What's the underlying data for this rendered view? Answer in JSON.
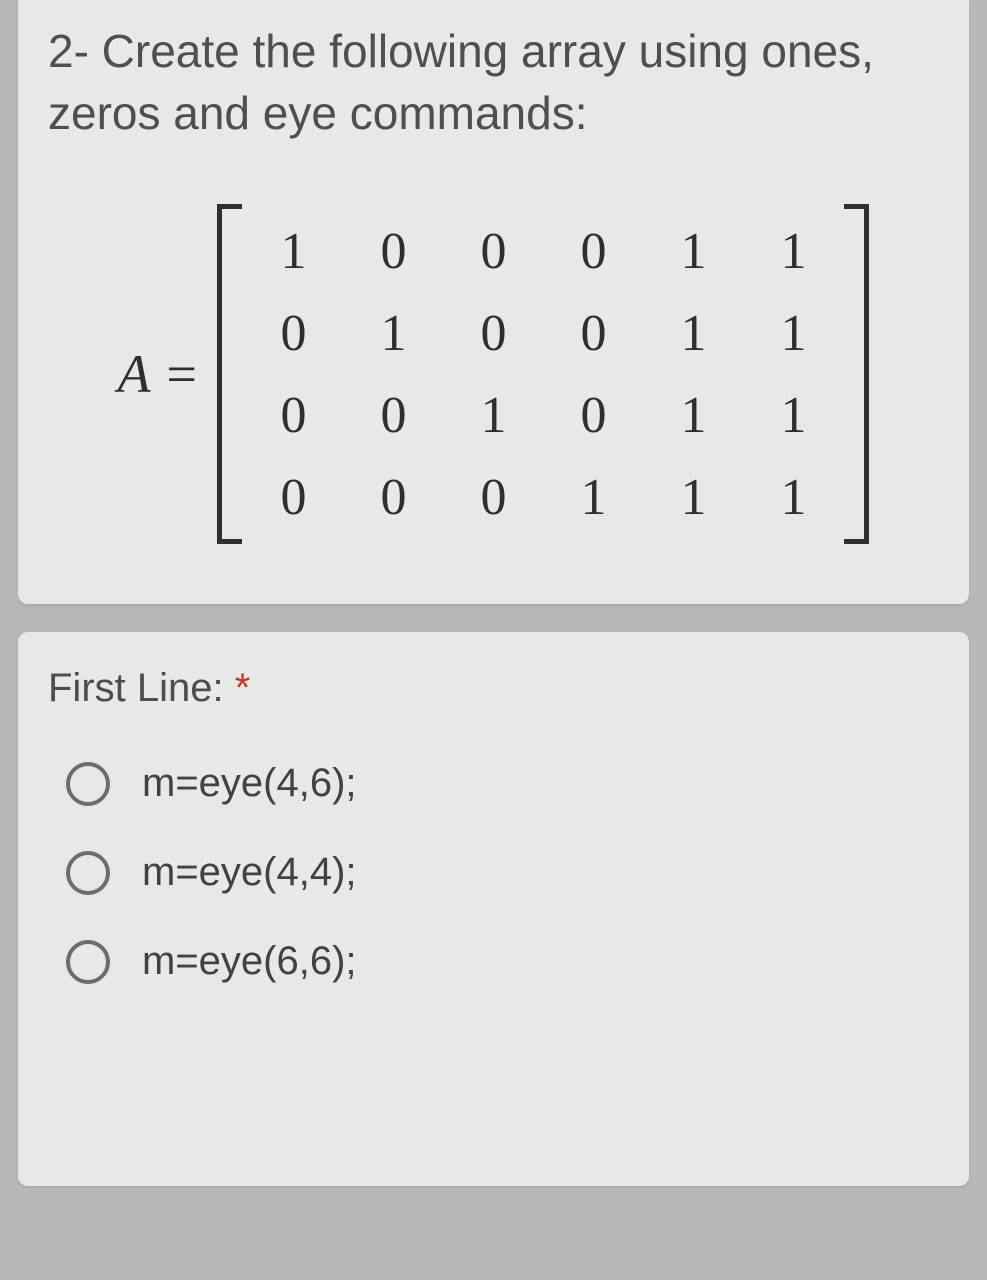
{
  "question": {
    "prompt": "2- Create the following array using ones, zeros and eye commands:",
    "matrix_label": "A =",
    "matrix": [
      [
        "1",
        "0",
        "0",
        "0",
        "1",
        "1"
      ],
      [
        "0",
        "1",
        "0",
        "0",
        "1",
        "1"
      ],
      [
        "0",
        "0",
        "1",
        "0",
        "1",
        "1"
      ],
      [
        "0",
        "0",
        "0",
        "1",
        "1",
        "1"
      ]
    ]
  },
  "answer_section": {
    "label": "First Line:",
    "required_mark": "*",
    "options": [
      {
        "text": "m=eye(4,6);"
      },
      {
        "text": "m=eye(4,4);"
      },
      {
        "text": "m=eye(6,6);"
      }
    ]
  }
}
